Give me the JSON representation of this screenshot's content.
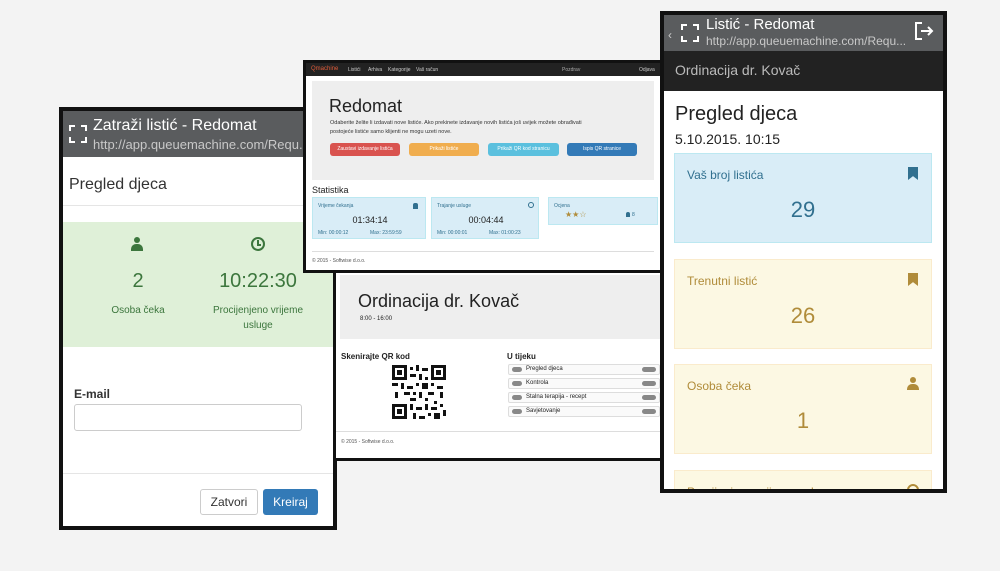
{
  "left_phone": {
    "title": "Zatraži listić - Redomat",
    "url": "http://app.queuemachine.com/Requ...",
    "heading": "Pregled djeca",
    "waiting_count": "2",
    "waiting_label": "Osoba čeka",
    "est_time": "10:22:30",
    "est_label_1": "Procijenjeno vrijeme",
    "est_label_2": "usluge",
    "email_label": "E-mail",
    "email_value": "",
    "close_label": "Zatvori",
    "create_label": "Kreiraj"
  },
  "desktop": {
    "brand": "Qmachine",
    "nav": [
      "Listići",
      "Arhiva",
      "Kategorije",
      "Vaš račun"
    ],
    "greeting": "Pozdrav",
    "logout": "Odjava",
    "title": "Redomat",
    "desc_1": "Odaberite želite li izdavati nove listiće. Ako prekinete izdavanje novih listića još uvijek možete obrađivati",
    "desc_2": "postojeće listiće samo klijenti ne mogu uzeti nove.",
    "btn_stop": "Zaustavi izdavanje listića",
    "btn_show": "Prikaži listiće",
    "btn_qr": "Prikaži QR kod stranicu",
    "btn_print": "Ispis QR stranice",
    "stats_title": "Statistika",
    "wait_label": "Vrijeme čekanja",
    "wait_value": "01:34:14",
    "wait_min": "Min: 00:00:12",
    "wait_max": "Max: 23:59:59",
    "service_label": "Trajanje usluge",
    "service_value": "00:04:44",
    "service_min": "Min: 00:00:01",
    "service_max": "Max: 01:00:23",
    "rating_label": "Ocjena",
    "rating_stars": "★★☆",
    "rating_count": "8",
    "footer": "© 2015 - Softwise d.o.o."
  },
  "display": {
    "title": "Ordinacija dr. Kovač",
    "hours": "8:00 - 16:00",
    "scan_label": "Skenirajte QR kod",
    "progress_label": "U tijeku",
    "items": [
      "Pregled djeca",
      "Kontrola",
      "Stalna terapija - recept",
      "Savjetovanje"
    ],
    "footer": "© 2015 - Softwise d.o.o."
  },
  "right_phone": {
    "title": "Listić - Redomat",
    "url": "http://app.queuemachine.com/Requ...",
    "header": "Ordinacija dr. Kovač",
    "heading": "Pregled djeca",
    "datetime": "5.10.2015. 10:15",
    "cards": [
      {
        "label": "Vaš broj listića",
        "value": "29"
      },
      {
        "label": "Trenutni listić",
        "value": "26"
      },
      {
        "label": "Osoba čeka",
        "value": "1"
      },
      {
        "label": "Procijenjeno vrijeme usluge",
        "value": ""
      }
    ]
  },
  "colors": {
    "success_bg": "#dff0d8",
    "success_text": "#3c763d",
    "info_bg": "#d9edf7",
    "info_text": "#31708f",
    "warning_bg": "#fcf8e3",
    "warning_text": "#b08c3a",
    "primary": "#337ab7"
  }
}
